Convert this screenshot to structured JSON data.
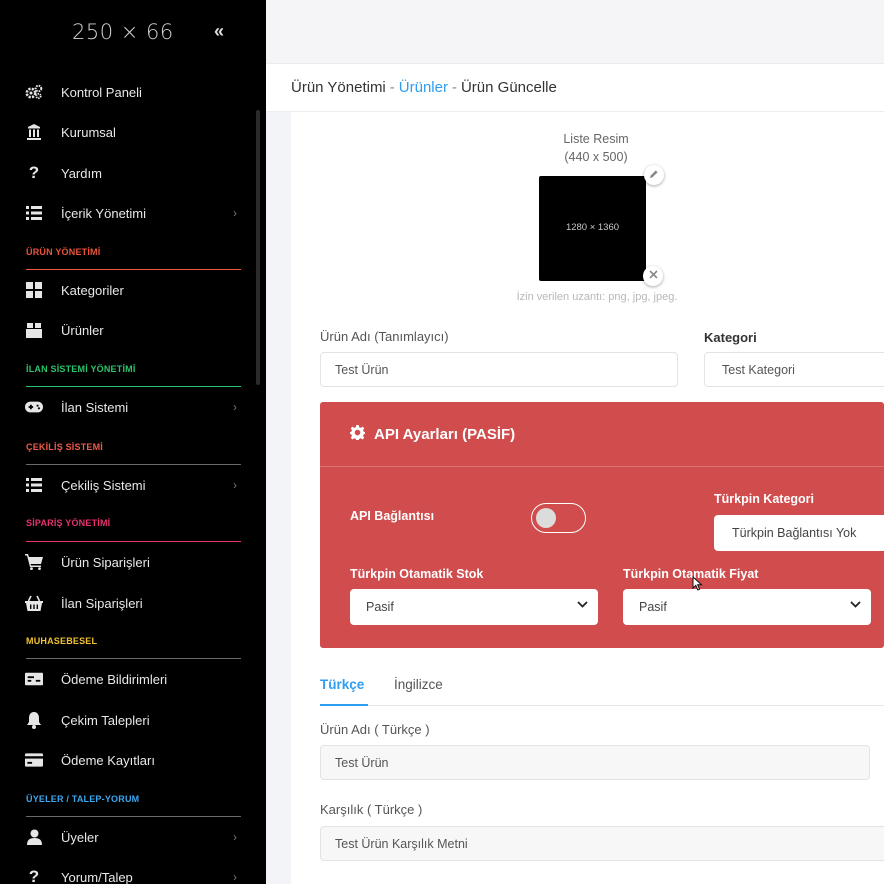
{
  "sidebar": {
    "logo": "250 × 66",
    "collapse": "«",
    "items": [
      {
        "label": "Kontrol Paneli"
      },
      {
        "label": "Kurumsal"
      },
      {
        "label": "Yardım"
      },
      {
        "label": "İçerik Yönetimi",
        "chevron": "›"
      },
      {
        "label": "Kategoriler"
      },
      {
        "label": "Ürünler"
      },
      {
        "label": "İlan Sistemi",
        "chevron": "›"
      },
      {
        "label": "Çekiliş Sistemi",
        "chevron": "›"
      },
      {
        "label": "Ürün Siparişleri"
      },
      {
        "label": "İlan Siparişleri"
      },
      {
        "label": "Ödeme Bildirimleri"
      },
      {
        "label": "Çekim Talepleri"
      },
      {
        "label": "Ödeme Kayıtları"
      },
      {
        "label": "Üyeler",
        "chevron": "›"
      },
      {
        "label": "Yorum/Talep",
        "chevron": "›"
      }
    ],
    "sections": [
      {
        "label": "ÜRÜN YÖNETİMİ",
        "color": "#e8543c"
      },
      {
        "label": "İLAN SİSTEMİ YÖNETİMİ",
        "color": "#2bc36b"
      },
      {
        "label": "ÇEKİLİŞ SİSTEMİ",
        "color": "#f05a4a"
      },
      {
        "label": "SİPARİŞ YÖNETİMİ",
        "color": "#e6326f"
      },
      {
        "label": "MUHASEBESEL",
        "color": "#f2c230"
      },
      {
        "label": "ÜYELER / TALEP-YORUM",
        "color": "#3aa7f0"
      }
    ]
  },
  "breadcrumb": {
    "part1": "Ürün Yönetimi",
    "sep": "-",
    "part2": "Ürünler",
    "part3": "Ürün Güncelle"
  },
  "image_upload": {
    "title": "Liste Resim",
    "size": "(440 x 500)",
    "placeholder_dim": "1280 × 1360",
    "hint": "İzin verilen uzantı: png, jpg, jpeg."
  },
  "form": {
    "product_name_label": "Ürün Adı (Tanımlayıcı)",
    "product_name_value": "Test Ürün",
    "category_label": "Kategori",
    "category_value": "Test Kategori"
  },
  "api": {
    "title": "API Ayarları (PASİF)",
    "connection_label": "API Bağlantısı",
    "connection_on": false,
    "turkpin_category_label": "Türkpin Kategori",
    "turkpin_category_value": "Türkpin Bağlantısı Yok",
    "auto_stock_label": "Türkpin Otamatik Stok",
    "auto_stock_value": "Pasif",
    "auto_price_label": "Türkpin Otamatik Fiyat",
    "auto_price_value": "Pasif"
  },
  "tabs": [
    {
      "label": "Türkçe",
      "active": true
    },
    {
      "label": "İngilizce",
      "active": false
    }
  ],
  "lang_fields": {
    "name_label": "Ürün Adı ( Türkçe )",
    "name_value": "Test Ürün",
    "response_label": "Karşılık ( Türkçe )",
    "response_value": "Test Ürün Karşılık Metni"
  },
  "colors": {
    "accent": "#2d9ef1",
    "api_panel": "#d14c4d",
    "sidebar_bg": "#000000"
  }
}
